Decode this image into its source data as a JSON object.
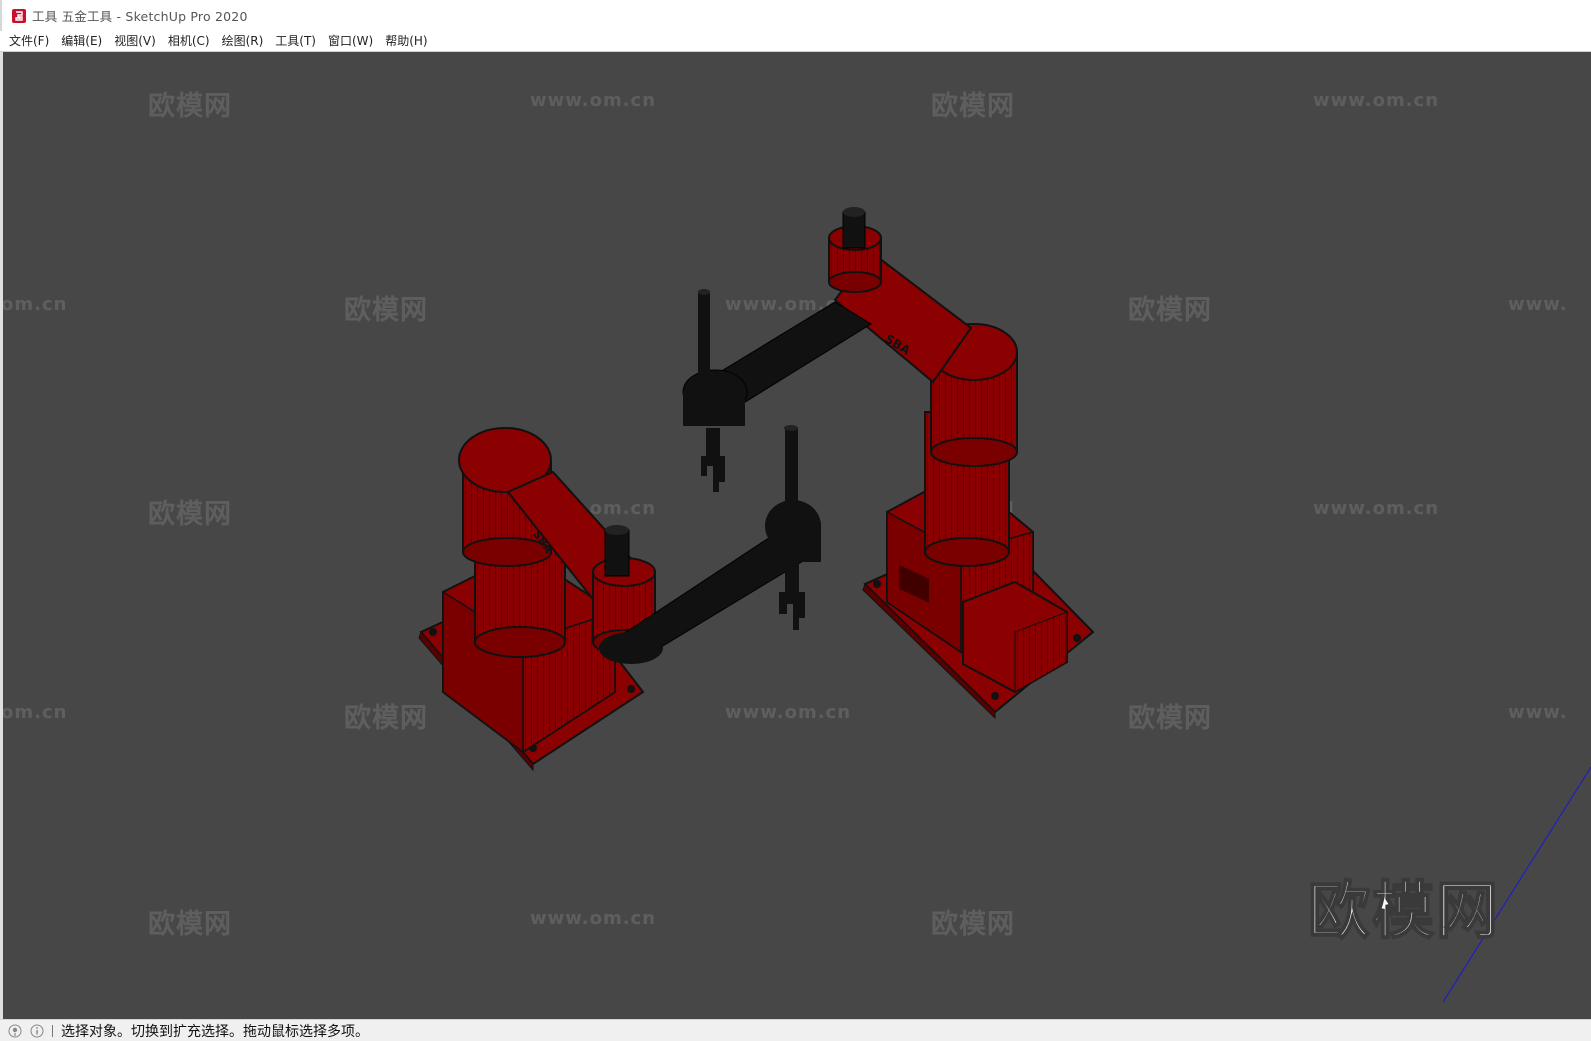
{
  "window": {
    "title": "工具 五金工具 - SketchUp Pro 2020"
  },
  "menu": {
    "items": [
      {
        "label": "文件(F)"
      },
      {
        "label": "编辑(E)"
      },
      {
        "label": "视图(V)"
      },
      {
        "label": "相机(C)"
      },
      {
        "label": "绘图(R)"
      },
      {
        "label": "工具(T)"
      },
      {
        "label": "窗口(W)"
      },
      {
        "label": "帮助(H)"
      }
    ]
  },
  "viewport": {
    "background_color": "#474747",
    "model_color_primary": "#8b0000",
    "model_color_secondary": "#111111",
    "model_label": "SBA",
    "watermark_cn": "欧模网",
    "watermark_url": "www.om.cn",
    "watermark_url_partial": "om.cn",
    "watermark_url_partial_right": "www.",
    "brand_logo": "欧模网"
  },
  "status": {
    "text": "选择对象。切换到扩充选择。拖动鼠标选择多项。"
  },
  "colors": {
    "accent_red": "#c8102e",
    "axis_blue": "#2020c0"
  }
}
